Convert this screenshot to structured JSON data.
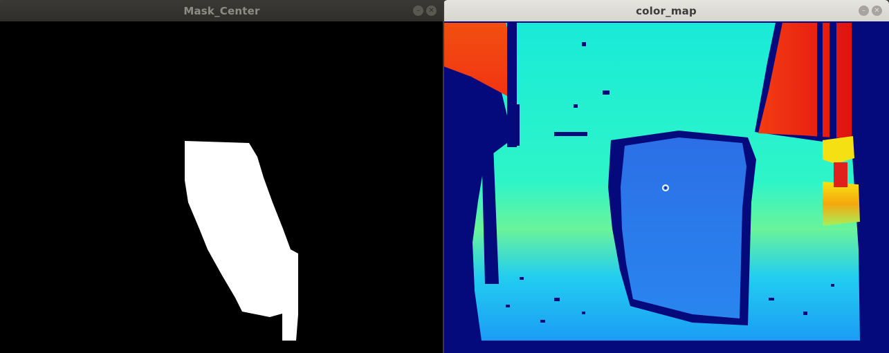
{
  "windows": [
    {
      "title": "Mask_Center",
      "buttons": {
        "minimize_icon": "minimize-icon",
        "close_icon": "close-icon"
      },
      "content": "binary-mask-image"
    },
    {
      "title": "color_map",
      "buttons": {
        "minimize_icon": "minimize-icon",
        "close_icon": "close-icon"
      },
      "content": "depth-colormap-image",
      "marker": "center-marker"
    }
  ],
  "colors": {
    "mask_background": "#000000",
    "mask_foreground": "#ffffff",
    "colormap_navy": "#04097c",
    "colormap_cyan": "#19f3df",
    "colormap_blue": "#2d7be8",
    "colormap_red": "#f01a12",
    "colormap_yellow": "#f4e013"
  }
}
